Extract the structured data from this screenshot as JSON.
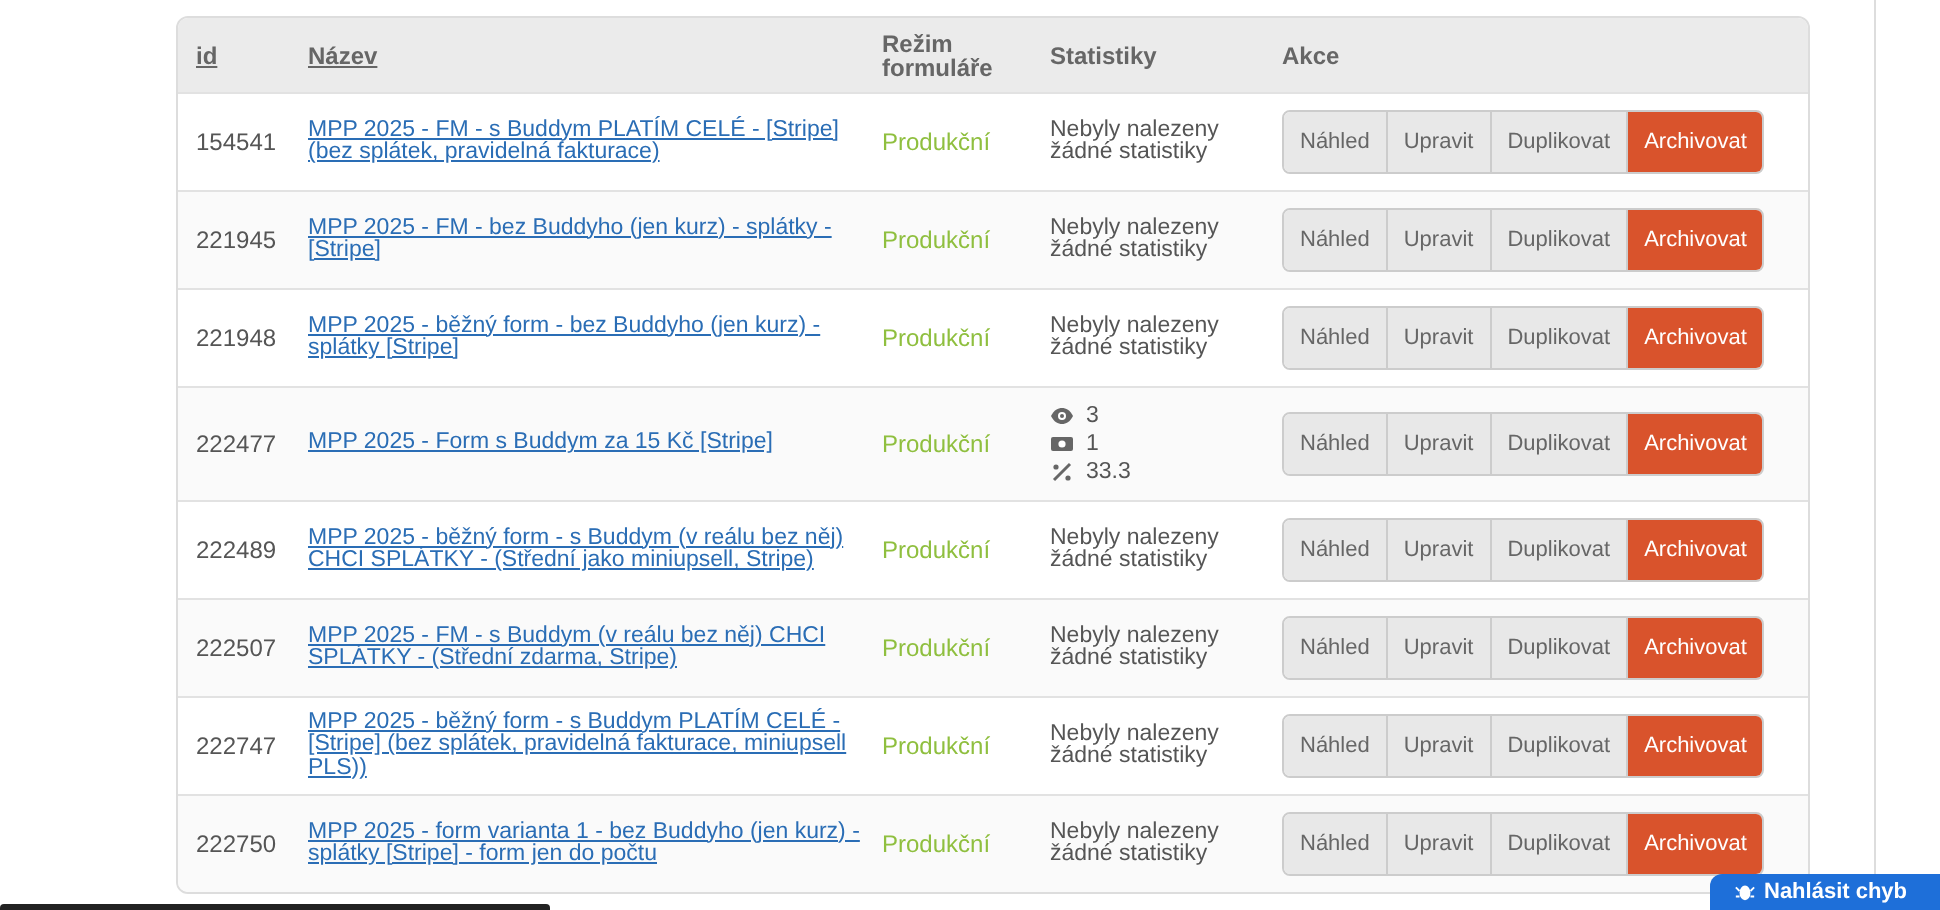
{
  "table": {
    "columns": [
      {
        "label": "id",
        "sortable": true
      },
      {
        "label": "Název",
        "sortable": true
      },
      {
        "label": "Režim formuláře",
        "sortable": false
      },
      {
        "label": "Statistiky",
        "sortable": false
      },
      {
        "label": "Akce",
        "sortable": false
      }
    ],
    "rows": [
      {
        "id": "154541",
        "name": "MPP 2025 - FM - s Buddym PLATÍM CELÉ - [Stripe] (bez splátek, pravidelná fakturace)",
        "mode": "Produkční",
        "stats": {
          "kind": "empty",
          "text": "Nebyly nalezeny žádné statistiky"
        },
        "actions": [
          "Náhled",
          "Upravit",
          "Duplikovat",
          "Archivovat"
        ]
      },
      {
        "id": "221945",
        "name": "MPP 2025 - FM - bez Buddyho (jen kurz) - splátky - [Stripe]",
        "mode": "Produkční",
        "stats": {
          "kind": "empty",
          "text": "Nebyly nalezeny žádné statistiky"
        },
        "actions": [
          "Náhled",
          "Upravit",
          "Duplikovat",
          "Archivovat"
        ]
      },
      {
        "id": "221948",
        "name": "MPP 2025 - běžný form - bez Buddyho (jen kurz) - splátky [Stripe]",
        "mode": "Produkční",
        "stats": {
          "kind": "empty",
          "text": "Nebyly nalezeny žádné statistiky"
        },
        "actions": [
          "Náhled",
          "Upravit",
          "Duplikovat",
          "Archivovat"
        ]
      },
      {
        "id": "222477",
        "name": "MPP 2025 - Form s Buddym za 15 Kč [Stripe]",
        "mode": "Produkční",
        "stats": {
          "kind": "counts",
          "items": [
            {
              "kind": "views",
              "value": "3"
            },
            {
              "kind": "payments",
              "value": "1"
            },
            {
              "kind": "percent",
              "value": "33.3"
            }
          ]
        },
        "actions": [
          "Náhled",
          "Upravit",
          "Duplikovat",
          "Archivovat"
        ]
      },
      {
        "id": "222489",
        "name": "MPP 2025 - běžný form - s Buddym (v reálu bez něj) CHCI SPLÁTKY - (Střední jako miniupsell, Stripe)",
        "mode": "Produkční",
        "stats": {
          "kind": "empty",
          "text": "Nebyly nalezeny žádné statistiky"
        },
        "actions": [
          "Náhled",
          "Upravit",
          "Duplikovat",
          "Archivovat"
        ]
      },
      {
        "id": "222507",
        "name": "MPP 2025 - FM - s Buddym (v reálu bez něj) CHCI SPLÁTKY - (Střední zdarma, Stripe)",
        "mode": "Produkční",
        "stats": {
          "kind": "empty",
          "text": "Nebyly nalezeny žádné statistiky"
        },
        "actions": [
          "Náhled",
          "Upravit",
          "Duplikovat",
          "Archivovat"
        ]
      },
      {
        "id": "222747",
        "name": "MPP 2025 - běžný form - s Buddym PLATÍM CELÉ - [Stripe] (bez splátek, pravidelná fakturace, miniupsell PLS))",
        "mode": "Produkční",
        "stats": {
          "kind": "empty",
          "text": "Nebyly nalezeny žádné statistiky"
        },
        "actions": [
          "Náhled",
          "Upravit",
          "Duplikovat",
          "Archivovat"
        ]
      },
      {
        "id": "222750",
        "name": "MPP 2025 - form varianta 1 - bez Buddyho (jen kurz) - splátky [Stripe] - form jen do počtu",
        "mode": "Produkční",
        "stats": {
          "kind": "empty",
          "text": "Nebyly nalezeny žádné statistiky"
        },
        "actions": [
          "Náhled",
          "Upravit",
          "Duplikovat",
          "Archivovat"
        ]
      }
    ]
  },
  "report_button": {
    "label": "Nahlásit chyb"
  }
}
